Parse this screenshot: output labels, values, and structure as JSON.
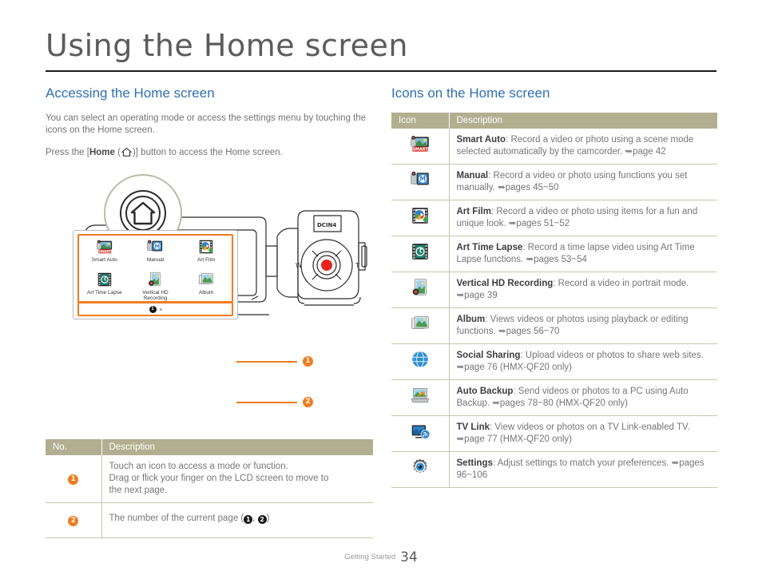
{
  "page_title": "Using the Home screen",
  "left": {
    "heading": "Accessing the Home screen",
    "intro": "You can select an operating mode or access the settings menu by touching the icons on the Home screen.",
    "press_pre": "Press the [",
    "press_home": "Home",
    "press_open": " (",
    "press_close": ")] button to access the Home screen.",
    "mockup": {
      "icons": [
        {
          "name": "Smart Auto",
          "icon": "smart-auto-icon"
        },
        {
          "name": "Manual",
          "icon": "manual-icon"
        },
        {
          "name": "Art Film",
          "icon": "art-film-icon"
        },
        {
          "name": "Art Time Lapse",
          "icon": "art-time-lapse-icon"
        },
        {
          "name": "Vertical HD Recording",
          "icon": "vertical-hd-icon"
        },
        {
          "name": "Album",
          "icon": "album-icon"
        }
      ],
      "page_indicator_active": "1",
      "callout_1": "1",
      "callout_2": "2"
    },
    "table": {
      "headers": [
        "No.",
        "Description"
      ],
      "rows": [
        {
          "no": "1",
          "desc_line1": "Touch an icon to access a mode or function.",
          "desc_line2": "Drag or flick your finger on the LCD screen to move to",
          "desc_line3": "the next page."
        },
        {
          "no": "2",
          "desc_pre": "The number of the current page (",
          "desc_b1": "1",
          "desc_mid": ", ",
          "desc_b2": "2",
          "desc_post": ")"
        }
      ]
    }
  },
  "right": {
    "heading": "Icons on the Home screen",
    "table": {
      "headers": [
        "Icon",
        "Description"
      ],
      "rows": [
        {
          "icon": "smart-auto-icon",
          "title": "Smart Auto",
          "desc": ": Record a video or photo using a scene mode selected automatically by the camcorder. ",
          "ref": "page 42"
        },
        {
          "icon": "manual-icon",
          "title": "Manual",
          "desc": ": Record a video or photo using functions you set manually. ",
          "ref": "pages 45~50"
        },
        {
          "icon": "art-film-icon",
          "title": "Art Film",
          "desc": ": Record a video or photo using items for a fun and unique look. ",
          "ref": "pages 51~52"
        },
        {
          "icon": "art-time-lapse-icon",
          "title": "Art Time Lapse",
          "desc": ": Record a time lapse video using Art Time Lapse functions. ",
          "ref": "pages 53~54"
        },
        {
          "icon": "vertical-hd-icon",
          "title": "Vertical HD Recording",
          "desc": ": Record a video in portrait mode. ",
          "ref": "page 39"
        },
        {
          "icon": "album-icon",
          "title": "Album",
          "desc": ": Views videos or photos using playback or editing functions. ",
          "ref": "pages 56~70"
        },
        {
          "icon": "social-sharing-icon",
          "title": "Social Sharing",
          "desc": ": Upload videos or photos to share web sites. ",
          "ref": "page 76 (HMX-QF20 only)"
        },
        {
          "icon": "auto-backup-icon",
          "title": "Auto Backup",
          "desc": ": Send videos or photos to a PC using Auto Backup. ",
          "ref": "pages 78~80 (HMX-QF20 only)"
        },
        {
          "icon": "tv-link-icon",
          "title": "TV Link",
          "desc": ": View videos or photos on a TV Link-enabled TV. ",
          "ref": "page 77 (HMX-QF20 only)"
        },
        {
          "icon": "settings-icon",
          "title": "Settings",
          "desc": ": Adjust settings to match your preferences. ",
          "ref": "pages 96~106"
        }
      ]
    }
  },
  "illustration": {
    "dcin_label": "DCIN4",
    "zoom_wide": "W",
    "zoom_tele": "T"
  },
  "footer": {
    "section": "Getting Started",
    "page_number": "34"
  },
  "colors": {
    "heading_blue": "#2f6fb5",
    "table_header": "#b2ae90",
    "accent_orange": "#ef7c1e",
    "body_text": "#747474",
    "rule": "#c9c5ab"
  }
}
